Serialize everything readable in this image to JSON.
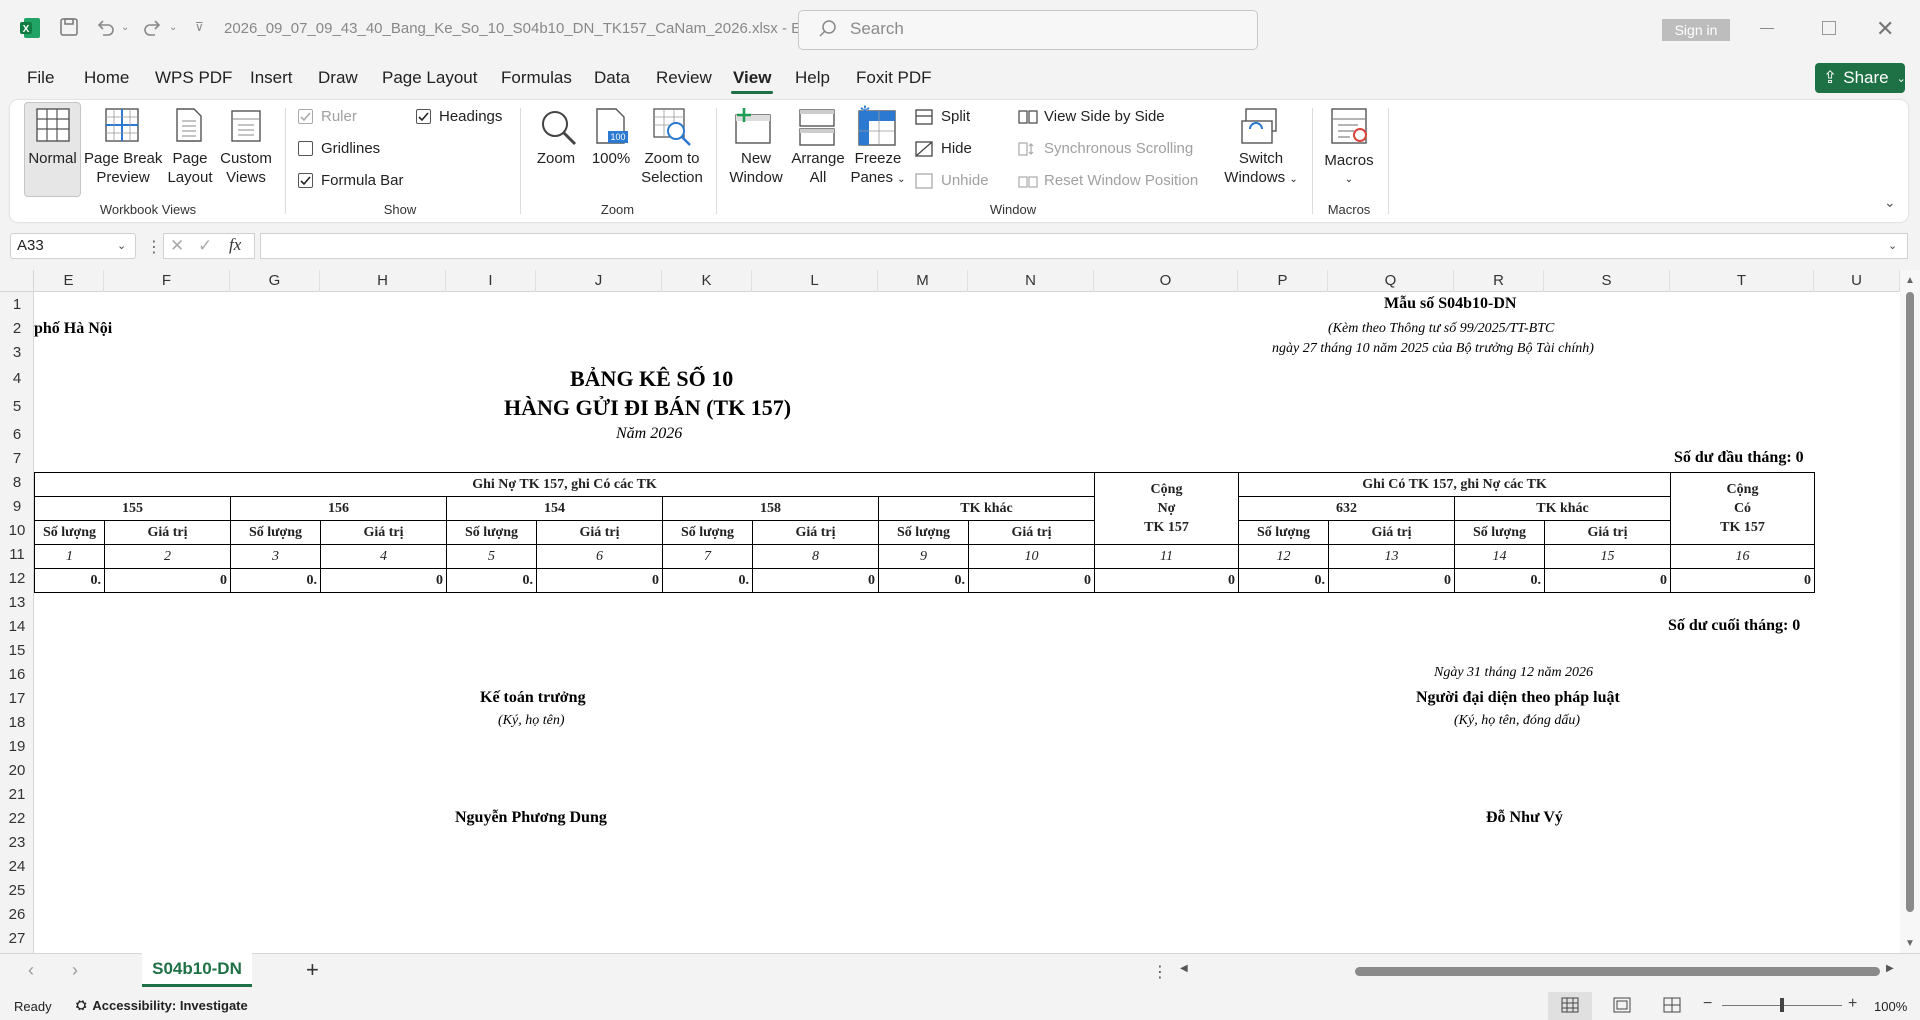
{
  "titlebar": {
    "filename": "2026_09_07_09_43_40_Bang_Ke_So_10_S04b10_DN_TK157_CaNam_2026.xlsx  -  E...",
    "search_placeholder": "Search",
    "signin_label": "Sign in"
  },
  "menu": {
    "items": [
      "File",
      "Home",
      "WPS PDF",
      "Insert",
      "Draw",
      "Page Layout",
      "Formulas",
      "Data",
      "Review",
      "View",
      "Help",
      "Foxit PDF"
    ],
    "active": "View",
    "share_label": "Share"
  },
  "ribbon": {
    "workbook_views": {
      "group_label": "Workbook Views",
      "normal": "Normal",
      "page_break_1": "Page Break",
      "page_break_2": "Preview",
      "page_layout_1": "Page",
      "page_layout_2": "Layout",
      "custom_1": "Custom",
      "custom_2": "Views"
    },
    "show": {
      "group_label": "Show",
      "ruler": "Ruler",
      "gridlines": "Gridlines",
      "formula_bar": "Formula Bar",
      "headings": "Headings"
    },
    "zoom": {
      "group_label": "Zoom",
      "zoom": "Zoom",
      "hundred": "100%",
      "zoom_sel_1": "Zoom to",
      "zoom_sel_2": "Selection"
    },
    "window": {
      "group_label": "Window",
      "new_window_1": "New",
      "new_window_2": "Window",
      "arrange_1": "Arrange",
      "arrange_2": "All",
      "freeze_1": "Freeze",
      "freeze_2": "Panes",
      "split": "Split",
      "hide": "Hide",
      "unhide": "Unhide",
      "side_by_side": "View Side by Side",
      "sync_scroll": "Synchronous Scrolling",
      "reset_pos": "Reset Window Position",
      "switch_1": "Switch",
      "switch_2": "Windows"
    },
    "macros": {
      "group_label": "Macros",
      "macros": "Macros"
    }
  },
  "formula_bar": {
    "name_box": "A33",
    "fx": "fx",
    "value": ""
  },
  "columns": [
    "E",
    "F",
    "G",
    "H",
    "I",
    "J",
    "K",
    "L",
    "M",
    "N",
    "O",
    "P",
    "Q",
    "R",
    "S",
    "T",
    "U"
  ],
  "rows": [
    "1",
    "2",
    "3",
    "4",
    "5",
    "6",
    "7",
    "8",
    "9",
    "10",
    "11",
    "12",
    "13",
    "14",
    "15",
    "16",
    "17",
    "18",
    "19",
    "20",
    "21",
    "22",
    "23",
    "24",
    "25",
    "26",
    "27"
  ],
  "sheet": {
    "form_code": "Mẫu số S04b10-DN",
    "circular_1": "(Kèm theo Thông tư số 99/2025/TT-BTC",
    "circular_2": "ngày 27 tháng 10 năm 2025 của Bộ trưởng Bộ Tài chính)",
    "city": "phố Hà Nội",
    "title_1": "BẢNG KÊ SỐ 10",
    "title_2": "HÀNG GỬI ĐI BÁN (TK 157)",
    "year": "Năm 2026",
    "opening_balance": "Số dư đầu tháng: 0",
    "closing_balance": "Số dư cuối tháng: 0",
    "table": {
      "debit_header": "Ghi Nợ TK 157, ghi Có các TK",
      "credit_header": "Ghi Có TK 157, ghi Nợ các TK",
      "total_debit_1": "Cộng",
      "total_debit_2": "Nợ",
      "total_debit_3": "TK 157",
      "total_credit_1": "Cộng",
      "total_credit_2": "Có",
      "total_credit_3": "TK 157",
      "debit_accounts": [
        "155",
        "156",
        "154",
        "158",
        "TK khác"
      ],
      "credit_accounts": [
        "632",
        "TK khác"
      ],
      "qty": "Số lượng",
      "val": "Giá trị",
      "index_row": [
        "1",
        "2",
        "3",
        "4",
        "5",
        "6",
        "7",
        "8",
        "9",
        "10",
        "11",
        "12",
        "13",
        "14",
        "15",
        "16"
      ],
      "data_row": [
        "0.",
        "0",
        "0.",
        "0",
        "0.",
        "0",
        "0.",
        "0",
        "0.",
        "0",
        "0",
        "0.",
        "0",
        "0.",
        "0",
        "0"
      ]
    },
    "date_line": "Ngày 31 tháng 12 năm 2026",
    "chief_accountant": "Kế toán trưởng",
    "sign_note_left": "(Ký, họ tên)",
    "legal_rep": "Người đại diện theo pháp luật",
    "sign_note_right": "(Ký, họ tên, đóng dấu)",
    "name_left": "Nguyễn Phương Dung",
    "name_right": "Đỗ Như Vý"
  },
  "tabs": {
    "active": "S04b10-DN",
    "add": "+"
  },
  "status": {
    "ready": "Ready",
    "accessibility": "Accessibility: Investigate",
    "zoom": "100%"
  },
  "colors": {
    "accent": "#1e7145",
    "ribbon_bg": "#ffffff",
    "chrome_bg": "#f3f3f3"
  }
}
